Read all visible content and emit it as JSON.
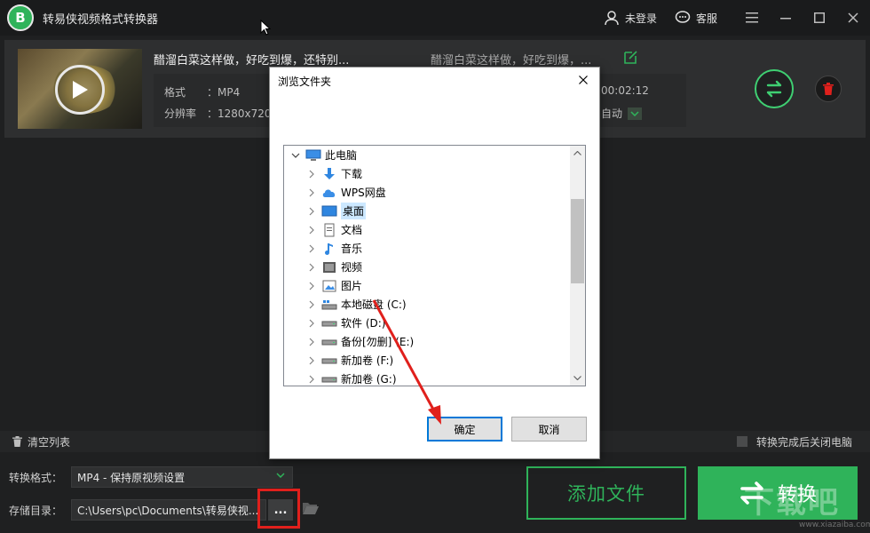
{
  "app": {
    "title": "转易侠视频格式转换器",
    "logo_text": "B"
  },
  "titlebar": {
    "user_label": "未登录",
    "service_label": "客服"
  },
  "video": {
    "title": "醋溜白菜这样做，好吃到爆，还特别...",
    "format_label": "格式",
    "format_value": "：MP4",
    "resolution_label": "分辨率",
    "resolution_value": "：1280x720",
    "output_title": "醋溜白菜这样做，好吃到爆，...",
    "duration": "00:02:12",
    "quality": "自动"
  },
  "listbar": {
    "clear_label": "清空列表",
    "close_after_label": "转换完成后关闭电脑"
  },
  "bottom": {
    "format_label": "转换格式：",
    "format_value": "MP4 - 保持原视频设置",
    "dir_label": "存储目录：",
    "dir_value": "C:\\Users\\pc\\Documents\\转易侠视...",
    "browse_label": "...",
    "add_file_label": "添加文件",
    "convert_label": "转换"
  },
  "dialog": {
    "title": "浏览文件夹",
    "ok_label": "确定",
    "cancel_label": "取消",
    "tree": [
      {
        "label": "此电脑",
        "icon": "computer-icon",
        "level": 0,
        "expanded": true
      },
      {
        "label": "下载",
        "icon": "download-icon",
        "level": 1
      },
      {
        "label": "WPS网盘",
        "icon": "cloud-icon",
        "level": 1
      },
      {
        "label": "桌面",
        "icon": "desktop-icon",
        "level": 1,
        "selected": true
      },
      {
        "label": "文档",
        "icon": "document-icon",
        "level": 1
      },
      {
        "label": "音乐",
        "icon": "music-icon",
        "level": 1
      },
      {
        "label": "视频",
        "icon": "video-icon",
        "level": 1
      },
      {
        "label": "图片",
        "icon": "picture-icon",
        "level": 1
      },
      {
        "label": "本地磁盘 (C:)",
        "icon": "system-drive-icon",
        "level": 1
      },
      {
        "label": "软件 (D:)",
        "icon": "drive-icon",
        "level": 1
      },
      {
        "label": "备份[勿删] (E:)",
        "icon": "drive-icon",
        "level": 1
      },
      {
        "label": "新加卷 (F:)",
        "icon": "drive-icon",
        "level": 1
      },
      {
        "label": "新加卷 (G:)",
        "icon": "drive-icon",
        "level": 1
      }
    ]
  },
  "watermark": {
    "text": "下载吧",
    "url": "www.xiazaiba.com"
  },
  "colors": {
    "accent": "#2fb35a",
    "highlight": "#e0201c",
    "selection": "#cce8ff"
  }
}
